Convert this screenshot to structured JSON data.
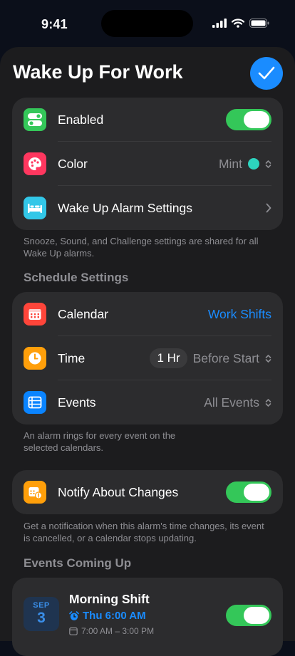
{
  "status": {
    "time": "9:41"
  },
  "header": {
    "title": "Wake Up For Work"
  },
  "main_card": {
    "enabled_label": "Enabled",
    "color_label": "Color",
    "color_value": "Mint",
    "color_hex": "#2dd4bf",
    "alarm_settings_label": "Wake Up Alarm Settings"
  },
  "main_footnote": "Snooze, Sound, and Challenge settings are shared for all Wake Up alarms.",
  "schedule": {
    "section_title": "Schedule Settings",
    "calendar_label": "Calendar",
    "calendar_value": "Work Shifts",
    "time_label": "Time",
    "time_offset": "1 Hr",
    "time_relation": "Before Start",
    "events_label": "Events",
    "events_value": "All Events"
  },
  "schedule_footnote": "An alarm rings for every event on the selected calendars.",
  "notify": {
    "label": "Notify About Changes",
    "footnote": "Get a notification when this alarm's time changes, its event is cancelled, or a calendar stops updating."
  },
  "upcoming": {
    "section_title": "Events Coming Up",
    "events": [
      {
        "month": "SEP",
        "day": "3",
        "title": "Morning Shift",
        "alarm_time": "Thu 6:00 AM",
        "range": "7:00 AM – 3:00 PM"
      }
    ]
  },
  "colors": {
    "accent": "#1a8cff",
    "toggle_on": "#34c759",
    "card_bg": "#2c2c2e",
    "sheet_bg": "#1c1c1e"
  }
}
